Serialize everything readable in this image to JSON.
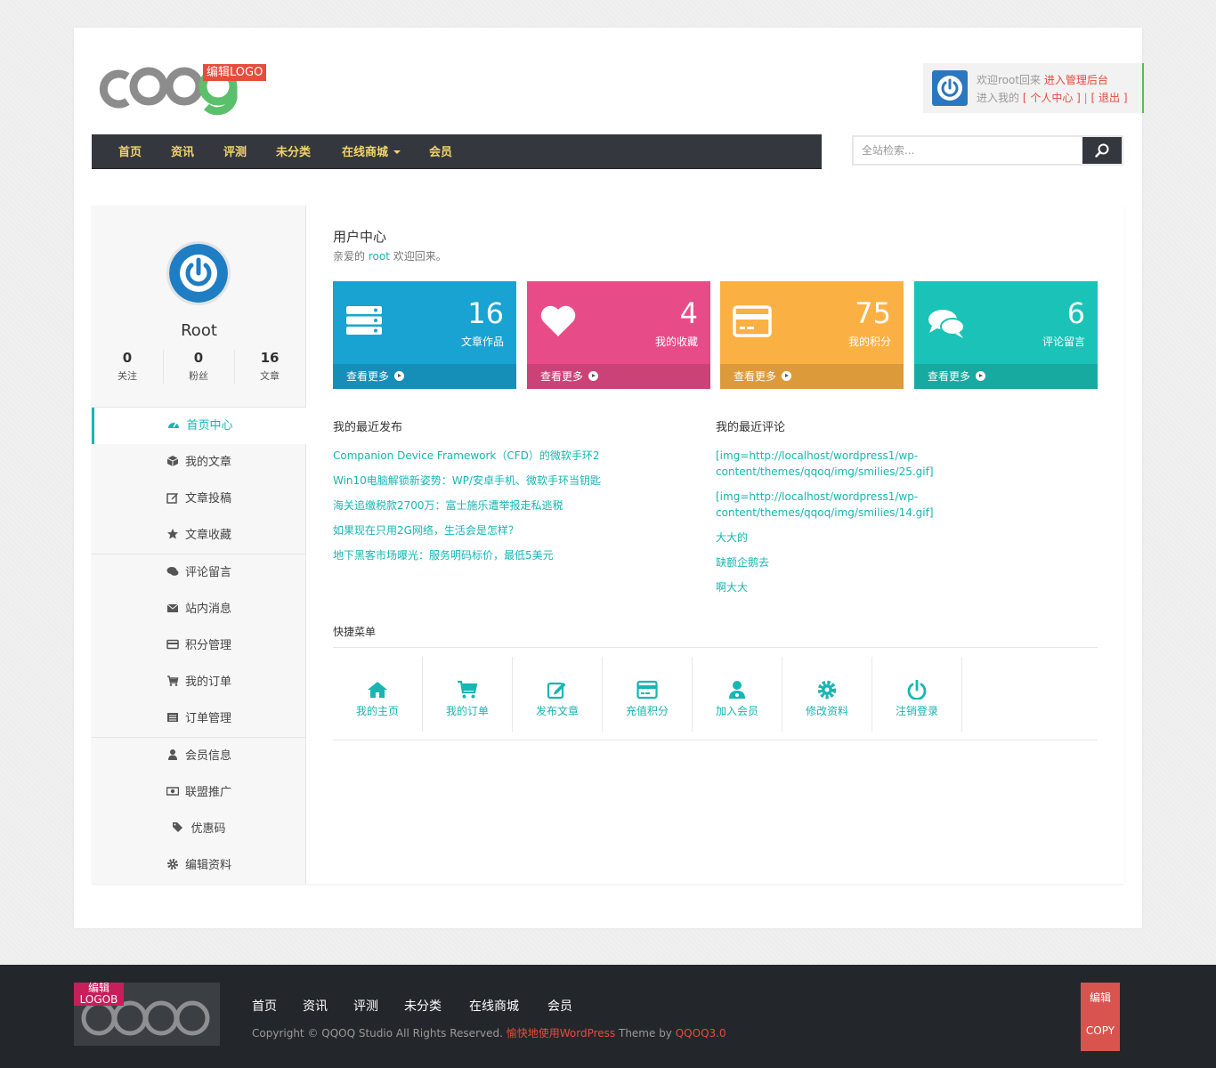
{
  "header": {
    "logo_edit_label": "编辑LOGO",
    "user_box": {
      "welcome_prefix": "欢迎root回来",
      "admin_link": "进入管理后台",
      "enter_prefix": "进入我的",
      "personal_center": "[ 个人中心 ]",
      "separator": " | ",
      "logout": "[ 退出 ]"
    }
  },
  "nav": {
    "items": [
      "首页",
      "资讯",
      "评测",
      "未分类",
      "在线商城",
      "会员"
    ]
  },
  "search": {
    "placeholder": "全站检索..."
  },
  "sidebar": {
    "user_name": "Root",
    "stats": [
      {
        "num": "0",
        "label": "关注"
      },
      {
        "num": "0",
        "label": "粉丝"
      },
      {
        "num": "16",
        "label": "文章"
      }
    ],
    "menu": [
      {
        "label": "首页中心",
        "icon": "dashboard-icon"
      },
      {
        "label": "我的文章",
        "icon": "cube-icon"
      },
      {
        "label": "文章投稿",
        "icon": "edit-icon"
      },
      {
        "label": "文章收藏",
        "icon": "star-icon"
      },
      {
        "label": "评论留言",
        "icon": "comments-icon"
      },
      {
        "label": "站内消息",
        "icon": "envelope-icon"
      },
      {
        "label": "积分管理",
        "icon": "credit-card-icon"
      },
      {
        "label": "我的订单",
        "icon": "cart-icon"
      },
      {
        "label": "订单管理",
        "icon": "list-icon"
      },
      {
        "label": "会员信息",
        "icon": "user-icon"
      },
      {
        "label": "联盟推广",
        "icon": "money-icon"
      },
      {
        "label": "优惠码",
        "icon": "tags-icon"
      },
      {
        "label": "编辑资料",
        "icon": "gear-icon"
      }
    ]
  },
  "main": {
    "title": "用户中心",
    "greeting_prefix": "亲爱的",
    "greeting_user": "root",
    "greeting_suffix": "欢迎回来。",
    "tiles": [
      {
        "num": "16",
        "label": "文章作品",
        "more": "查看更多",
        "color": "#18a3d2",
        "icon": "server-icon"
      },
      {
        "num": "4",
        "label": "我的收藏",
        "more": "查看更多",
        "color": "#e84c88",
        "icon": "heart-icon"
      },
      {
        "num": "75",
        "label": "我的积分",
        "more": "查看更多",
        "color": "#fbb043",
        "icon": "credit-card-icon"
      },
      {
        "num": "6",
        "label": "评论留言",
        "more": "查看更多",
        "color": "#1ac2b7",
        "icon": "comments-icon"
      }
    ],
    "recent_posts_title": "我的最近发布",
    "recent_posts": [
      "Companion Device Framework（CFD）的微软手环2",
      "Win10电脑解锁新姿势：WP/安卓手机、微软手环当钥匙",
      "海关追缴税款2700万：富士施乐遭举报走私逃税",
      "如果现在只用2G网络，生活会是怎样？",
      "地下黑客市场曝光：服务明码标价，最低5美元"
    ],
    "recent_comments_title": "我的最近评论",
    "recent_comments": [
      [
        "[img=http://localhost/wordpress1/wp-",
        "content/themes/qqoq/img/smilies/25.gif]"
      ],
      [
        "[img=http://localhost/wordpress1/wp-",
        "content/themes/qqoq/img/smilies/14.gif]"
      ],
      [
        "大大的"
      ],
      [
        "缺额企鹅去"
      ],
      [
        "啊大大"
      ]
    ],
    "quick_title": "快捷菜单",
    "quick": [
      {
        "label": "我的主页",
        "icon": "home-icon"
      },
      {
        "label": "我的订单",
        "icon": "cart-icon"
      },
      {
        "label": "发布文章",
        "icon": "edit-icon"
      },
      {
        "label": "充值积分",
        "icon": "credit-card-icon"
      },
      {
        "label": "加入会员",
        "icon": "user-icon"
      },
      {
        "label": "修改资料",
        "icon": "gear-icon"
      },
      {
        "label": "注销登录",
        "icon": "power-icon"
      }
    ]
  },
  "footer": {
    "logo_edit_label_1": "编辑",
    "logo_edit_label_2": "LOGOB",
    "nav": [
      "首页",
      "资讯",
      "评测",
      "未分类",
      "在线商城",
      "会员"
    ],
    "copyright_prefix": "Copyright © QQOQ Studio All Rights Reserved. ",
    "copyright_link": "愉快地使用WordPress",
    "copyright_mid": " Theme by ",
    "copyright_theme": "QQOQ3.0",
    "edit_label": "编辑",
    "copy_label": "COPY"
  },
  "colors": {
    "accent": "#17b6b3",
    "nav_bg": "#34373d",
    "nav_text": "#f1d46b",
    "footer_bg": "#23272b",
    "highlight_red": "#e74c3c"
  }
}
